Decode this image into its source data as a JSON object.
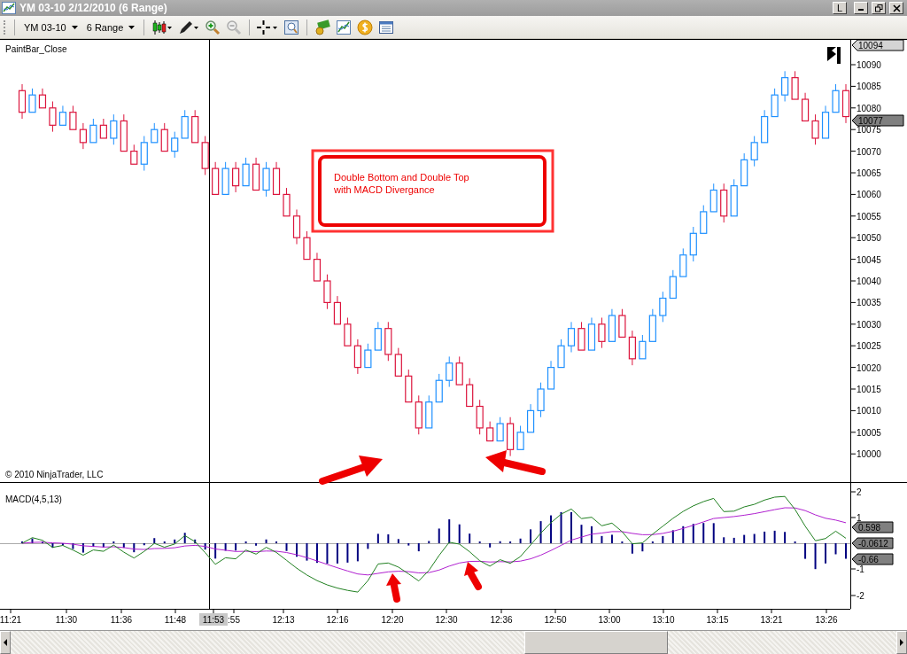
{
  "window": {
    "title": "YM 03-10  2/12/2010 (6 Range)",
    "mode_button": "L"
  },
  "toolbar": {
    "instrument": "YM 03-10",
    "period": "6 Range"
  },
  "price_panel": {
    "indicator_label": "PaintBar_Close",
    "copyright": "© 2010 NinjaTrader, LLC",
    "y_ticks": [
      "10090",
      "10085",
      "10080",
      "10075",
      "10070",
      "10065",
      "10060",
      "10055",
      "10050",
      "10045",
      "10040",
      "10035",
      "10030",
      "10025",
      "10020",
      "10015",
      "10010",
      "10005",
      "10000"
    ],
    "markers": [
      {
        "text": "10094",
        "kind": "high"
      },
      {
        "text": "10077",
        "kind": "last"
      }
    ],
    "annotation": [
      "Double Bottom and Double Top",
      "with MACD Divergance"
    ]
  },
  "macd_panel": {
    "label": "MACD(4,5,13)",
    "y_ticks": [
      "2",
      "1",
      "-1",
      "-2"
    ],
    "markers": [
      "0.598",
      "-0.0612",
      "-0.66"
    ]
  },
  "time_axis": {
    "ticks": [
      {
        "label": "11:21",
        "selected": false
      },
      {
        "label": "11:30",
        "selected": false
      },
      {
        "label": "11:36",
        "selected": false
      },
      {
        "label": "11:48",
        "selected": false
      },
      {
        "label": "11:53",
        "selected": true
      },
      {
        "label": ":55",
        "selected": false
      },
      {
        "label": "12:13",
        "selected": false
      },
      {
        "label": "12:16",
        "selected": false
      },
      {
        "label": "12:20",
        "selected": false
      },
      {
        "label": "12:30",
        "selected": false
      },
      {
        "label": "12:36",
        "selected": false
      },
      {
        "label": "12:50",
        "selected": false
      },
      {
        "label": "13:00",
        "selected": false
      },
      {
        "label": "13:10",
        "selected": false
      },
      {
        "label": "13:15",
        "selected": false
      },
      {
        "label": "13:21",
        "selected": false
      },
      {
        "label": "13:26",
        "selected": false
      }
    ]
  }
}
